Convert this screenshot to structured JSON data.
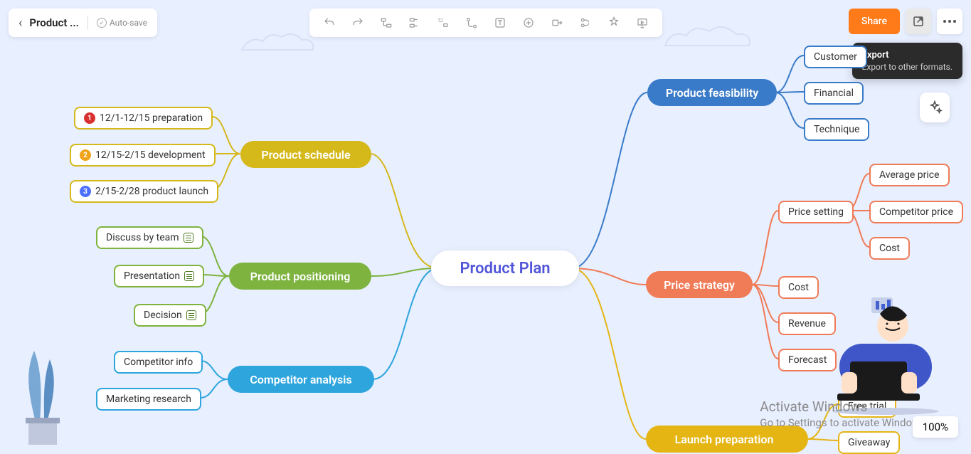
{
  "header": {
    "title": "Product ...",
    "autosave": "Auto-save"
  },
  "share": {
    "label": "Share"
  },
  "tooltip": {
    "title": "Export",
    "desc": "Export to other formats."
  },
  "zoom": {
    "value": "100%"
  },
  "watermark": {
    "line1": "Activate Windows",
    "line2": "Go to Settings to activate Windows."
  },
  "map": {
    "center": "Product Plan",
    "schedule": {
      "label": "Product schedule",
      "i1": "12/1-12/15 preparation",
      "i2": "12/15-2/15 development",
      "i3": "2/15-2/28 product launch"
    },
    "positioning": {
      "label": "Product positioning",
      "i1": "Discuss by team",
      "i2": "Presentation",
      "i3": "Decision"
    },
    "competitor": {
      "label": "Competitor analysis",
      "i1": "Competitor info",
      "i2": "Marketing research"
    },
    "feasibility": {
      "label": "Product feasibility",
      "i1": "Customer",
      "i2": "Financial",
      "i3": "Technique"
    },
    "price": {
      "label": "Price strategy",
      "setting": {
        "label": "Price setting",
        "i1": "Average price",
        "i2": "Competitor price",
        "i3": "Cost"
      },
      "i2": "Cost",
      "i3": "Revenue",
      "i4": "Forecast"
    },
    "launch": {
      "label": "Launch preparation",
      "i1": "Free trial",
      "i2": "Giveaway"
    }
  }
}
